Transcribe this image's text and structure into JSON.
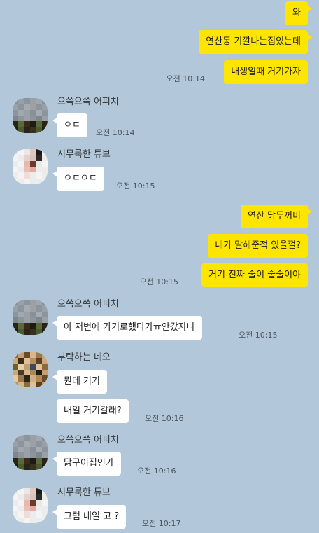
{
  "users": {
    "peach": "으쓱으쓱 어피치",
    "tube": "시무룩한 튜브",
    "neo": "부탁하는 네오"
  },
  "messages": {
    "m1": "와",
    "m2": "연산동 기깔나는집있는데",
    "m3": "내생일때 거기가자",
    "t3": "오전 10:14",
    "m4": "ㅇㄷ",
    "t4": "오전 10:14",
    "m5": "ㅇㄷㅇㄷ",
    "t5": "오전 10:15",
    "m6": "연산 닭두꺼비",
    "m7": "내가 말해준적 있을껄?",
    "m8": "거기 진짜 술이 술술이야",
    "t8": "오전 10:15",
    "m9": "아 저번에 가기로했다가ㅠ안갔자나",
    "t9": "오전 10:15",
    "m10": "뭔데 거기",
    "m11": "내일 거기갈래?",
    "t11": "오전 10:16",
    "m12": "닭구이집인가",
    "t12": "오전 10:16",
    "m13": "그럼 내일 고 ?",
    "t13": "오전 10:17"
  },
  "colors": {
    "background": "#b2c7d9",
    "my_bubble": "#fee500",
    "other_bubble": "#ffffff"
  }
}
